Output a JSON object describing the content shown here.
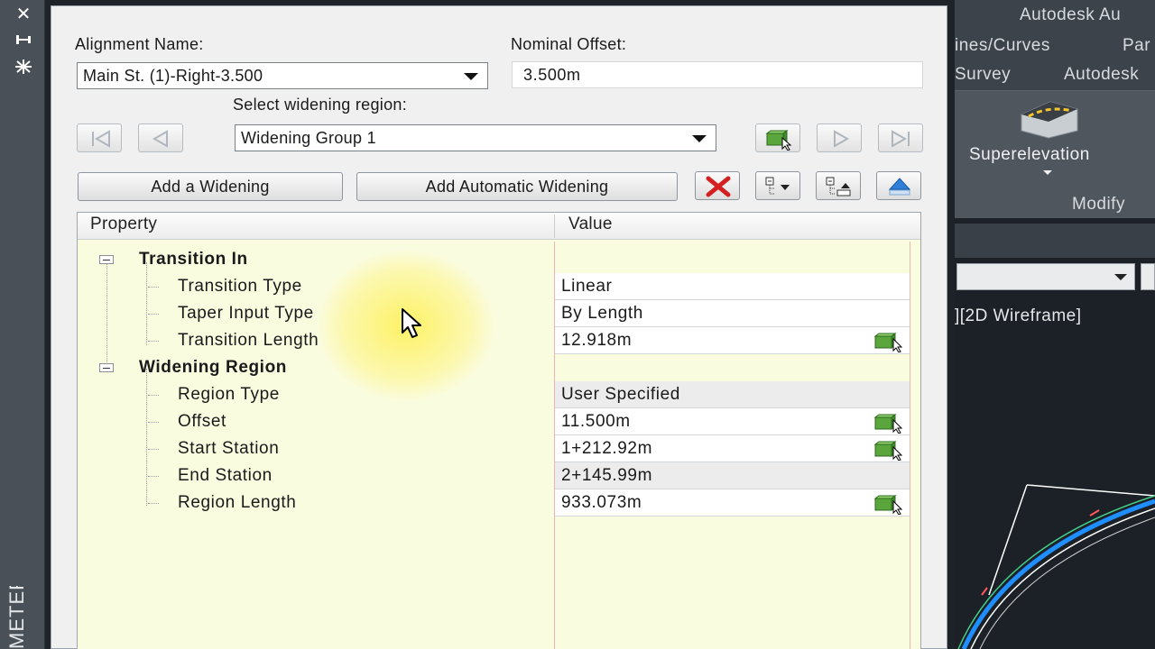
{
  "palette": {
    "close_icon": "close-icon",
    "title_vertical": "METERS"
  },
  "dialog": {
    "alignment_name_label": "Alignment Name:",
    "alignment_name_value": "Main St. (1)-Right-3.500",
    "nominal_offset_label": "Nominal Offset:",
    "nominal_offset_value": "3.500m",
    "select_region_label": "Select widening region:",
    "region_value": "Widening Group 1",
    "add_widening_label": "Add a Widening",
    "add_auto_widening_label": "Add Automatic Widening"
  },
  "grid": {
    "property_header": "Property",
    "value_header": "Value",
    "groups": [
      {
        "name": "Transition In",
        "rows": [
          {
            "name": "Transition Type",
            "value": "Linear",
            "pick": false,
            "readonly": false
          },
          {
            "name": "Taper Input Type",
            "value": "By Length",
            "pick": false,
            "readonly": false
          },
          {
            "name": "Transition Length",
            "value": "12.918m",
            "pick": true,
            "readonly": false
          }
        ]
      },
      {
        "name": "Widening Region",
        "rows": [
          {
            "name": "Region Type",
            "value": "User Specified",
            "pick": false,
            "readonly": true
          },
          {
            "name": "Offset",
            "value": "11.500m",
            "pick": true,
            "readonly": false
          },
          {
            "name": "Start Station",
            "value": "1+212.92m",
            "pick": true,
            "readonly": false
          },
          {
            "name": "End Station",
            "value": "2+145.99m",
            "pick": false,
            "readonly": true
          },
          {
            "name": "Region Length",
            "value": "933.073m",
            "pick": true,
            "readonly": false
          }
        ]
      }
    ]
  },
  "app": {
    "title": "Autodesk Au",
    "tab_lines_curves": "ines/Curves",
    "tab_par": "Par",
    "tab_survey": "Survey",
    "tab_autodesk": "Autodesk",
    "superelevation_label": "Superelevation",
    "modify_label": "Modify",
    "viewport_label": "][2D Wireframe]"
  },
  "colors": {
    "grid_background": "#fafce0",
    "highlight": "#ffee3c",
    "accent_green": "#5aa63c",
    "delete_red": "#d42020"
  }
}
